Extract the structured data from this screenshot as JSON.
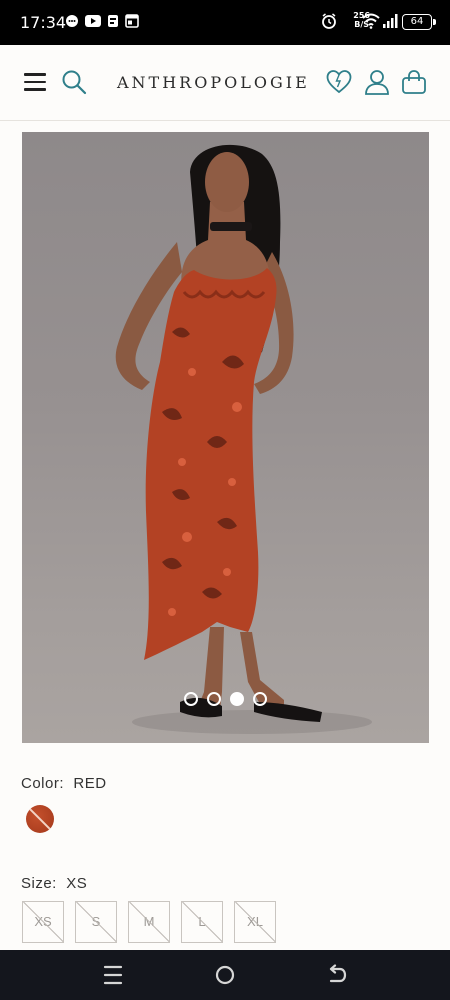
{
  "status_bar": {
    "time": "17:34",
    "net_speed_value": "256",
    "net_speed_unit": "B/S",
    "battery": "64",
    "icons": [
      "chat-bubble-icon",
      "youtube-icon",
      "app-notification-icon",
      "calendar-icon",
      "alarm-icon",
      "wifi-icon",
      "signal-icon",
      "battery-icon"
    ]
  },
  "header": {
    "brand": "ANTHROPOLOGIE",
    "icons": [
      "menu-icon",
      "search-icon",
      "heart-icon",
      "account-icon",
      "bag-icon"
    ],
    "accent_color": "#2f7f8a"
  },
  "product": {
    "carousel": {
      "total": 4,
      "active_index": 3
    },
    "color": {
      "label": "Color:",
      "value": "RED",
      "swatch_color": "#b84326"
    },
    "size": {
      "label": "Size:",
      "value": "XS",
      "options": [
        "XS",
        "S",
        "M",
        "L",
        "XL"
      ]
    }
  },
  "nav_bar": {
    "icons": [
      "recent-apps-icon",
      "home-icon",
      "back-icon"
    ]
  }
}
